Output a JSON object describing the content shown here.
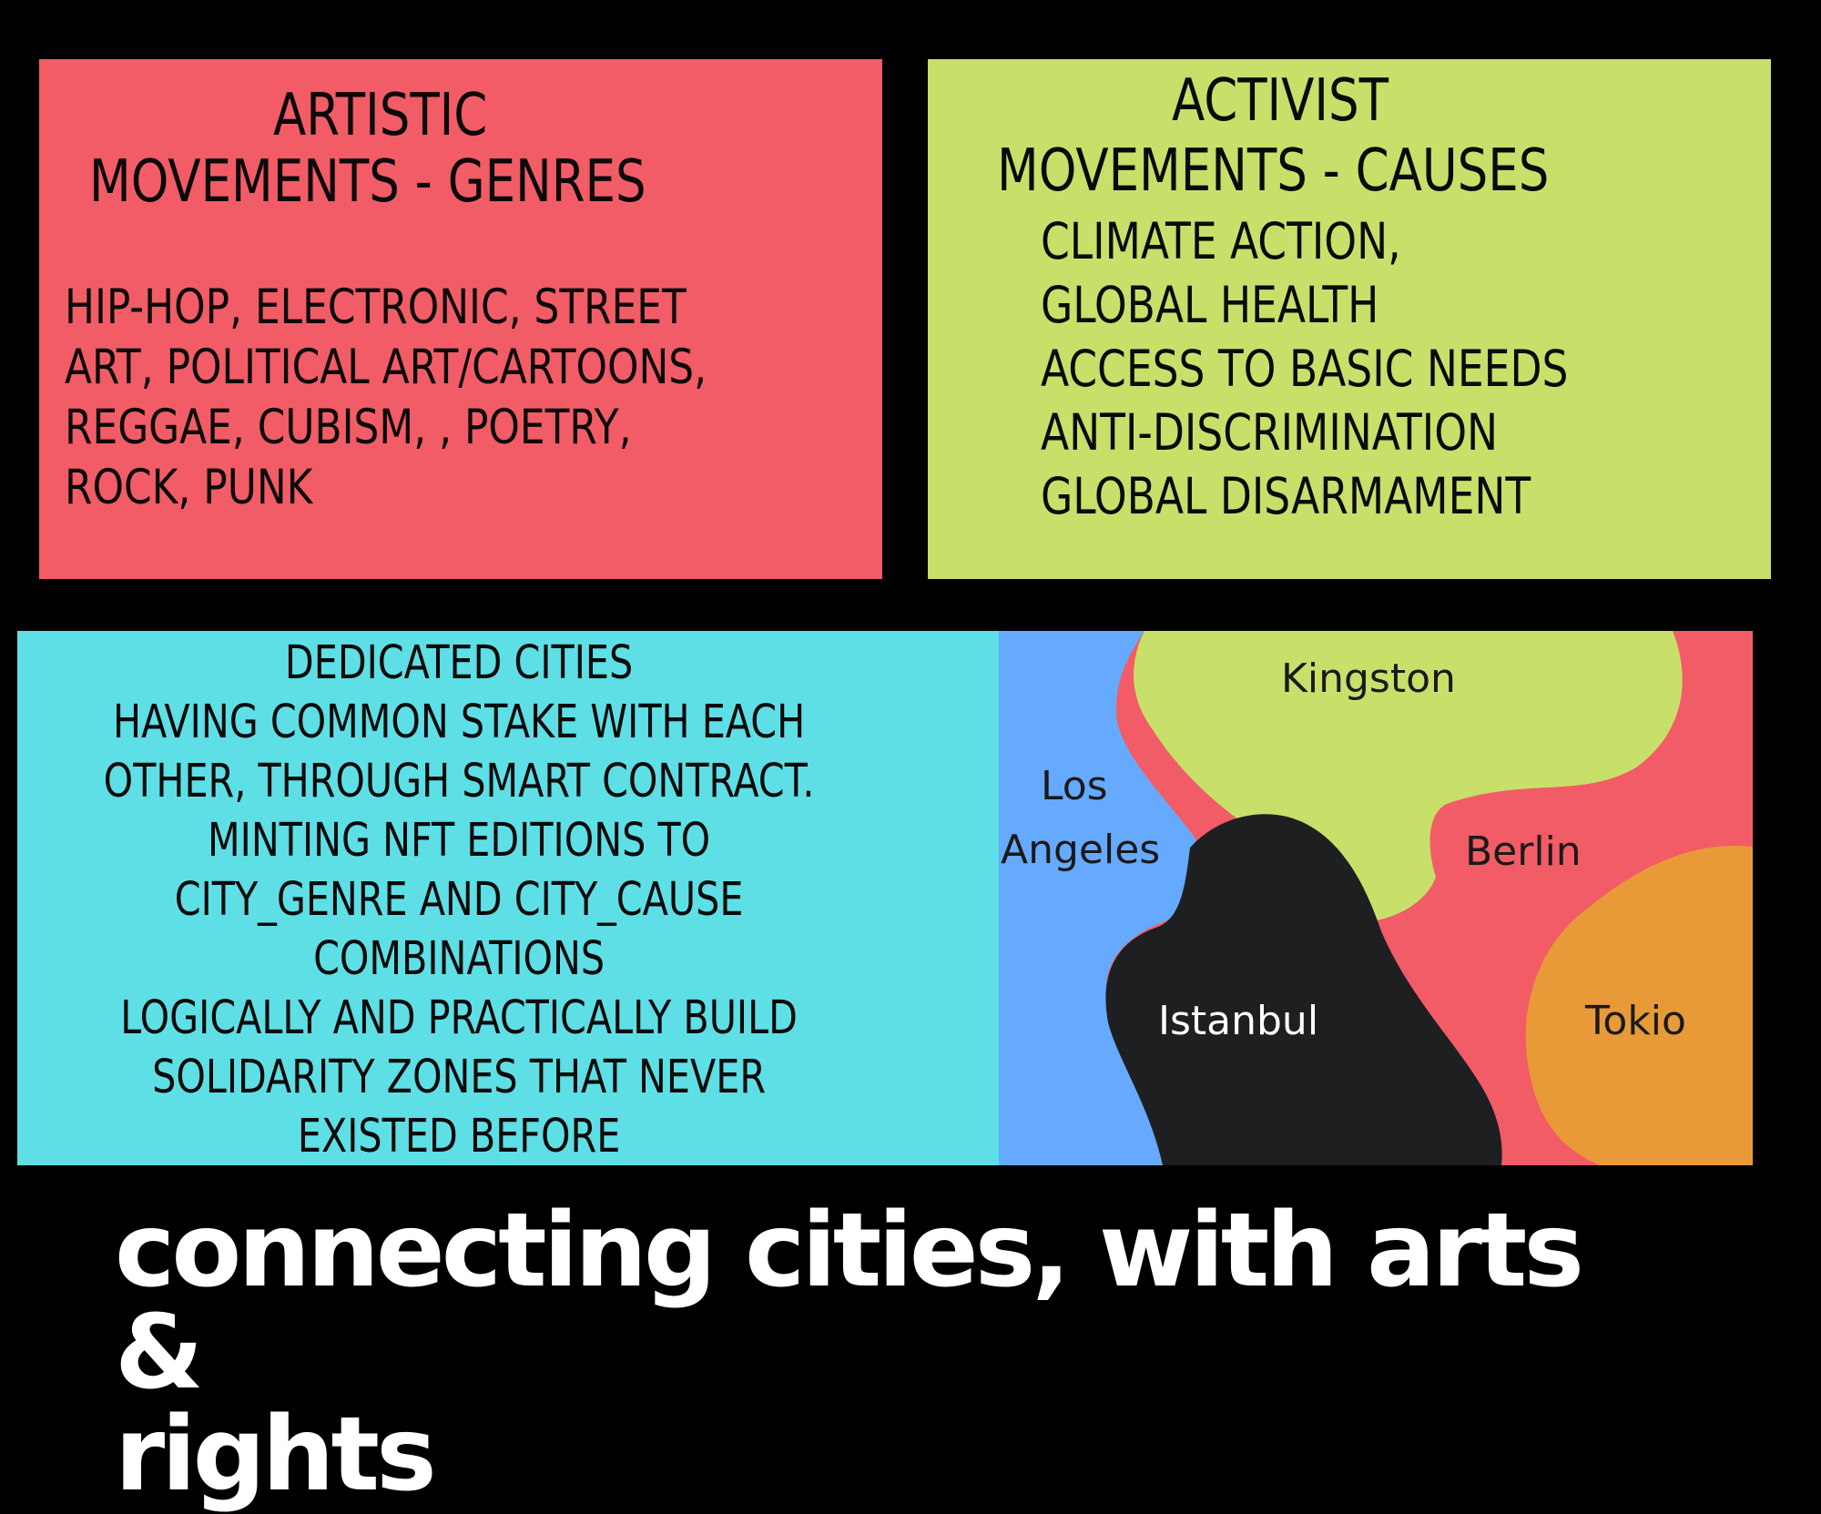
{
  "artistic": {
    "title_line1": "ARTISTIC",
    "title_line2": "MOVEMENTS - GENRES",
    "body_lines": [
      "HIP-HOP, ELECTRONIC, STREET",
      "ART, POLITICAL ART/CARTOONS,",
      "REGGAE, CUBISM, , POETRY,",
      "ROCK, PUNK"
    ],
    "color": "#F25C66"
  },
  "activist": {
    "title_line1": "ACTIVIST",
    "title_line2": "MOVEMENTS - CAUSES",
    "causes": [
      "CLIMATE ACTION,",
      "GLOBAL HEALTH",
      "ACCESS TO BASIC NEEDS",
      "ANTI-DISCRIMINATION",
      "GLOBAL DISARMAMENT"
    ],
    "color": "#C8E06A"
  },
  "cities_text": {
    "lines": [
      "DEDICATED CITIES",
      "HAVING COMMON STAKE WITH EACH",
      "OTHER, THROUGH SMART CONTRACT.",
      "MINTING NFT EDITIONS TO",
      "CITY_GENRE AND CITY_CAUSE",
      "COMBINATIONS",
      "LOGICALLY AND PRACTICALLY BUILD",
      "SOLIDARITY ZONES THAT NEVER",
      "EXISTED BEFORE"
    ],
    "color": "#5EDFE6"
  },
  "map": {
    "cities": {
      "kingston": "Kingston",
      "los_angeles_line1": "Los",
      "los_angeles_line2": "Angeles",
      "berlin": "Berlin",
      "istanbul": "Istanbul",
      "tokio": "Tokio"
    },
    "colors": {
      "kingston": "#C8E06A",
      "los_angeles": "#66AAFF",
      "berlin": "#F25C66",
      "istanbul": "#1E1F21",
      "tokio": "#E89A38"
    }
  },
  "tagline": {
    "line1": "connecting cities, with arts &",
    "line2": "rights"
  }
}
